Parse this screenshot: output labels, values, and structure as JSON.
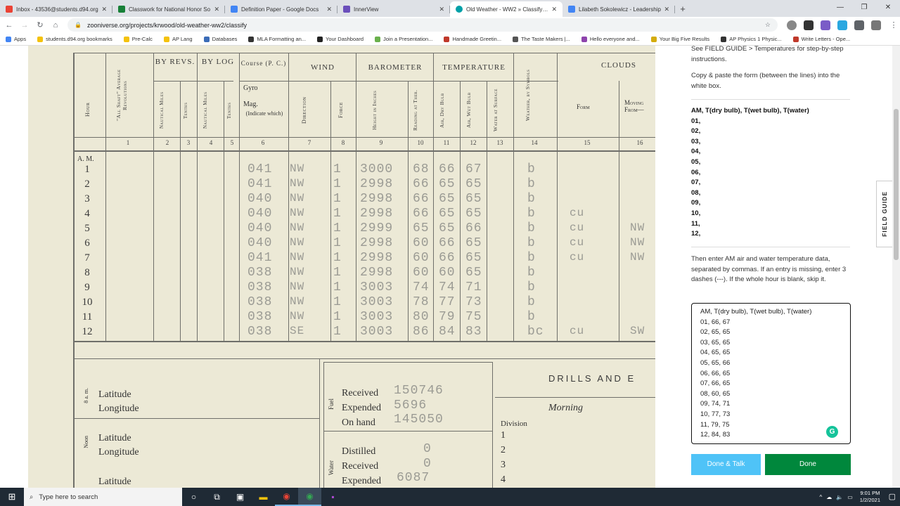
{
  "browser": {
    "tabs": [
      {
        "title": "Inbox - 43536@students.d94.org",
        "color": "#ea4335"
      },
      {
        "title": "Classwork for National Honor So",
        "color": "#188038"
      },
      {
        "title": "Definition Paper - Google Docs",
        "color": "#4285f4"
      },
      {
        "title": "InnerView",
        "color": "#6b4fbb"
      },
      {
        "title": "Old Weather - WW2 » Classify —",
        "color": "#00a0a8"
      },
      {
        "title": "Lilabeth Sokolewicz - Leadership",
        "color": "#4285f4"
      }
    ],
    "url": "zooniverse.org/projects/krwood/old-weather-ww2/classify",
    "bookmarks": [
      "Apps",
      "students.d94.org bookmarks",
      "Pre-Calc",
      "AP Lang",
      "Databases",
      "MLA Formatting an...",
      "Your Dashboard",
      "Join a Presentation...",
      "Handmade Greetin...",
      "The Taste Makers |...",
      "Hello everyone and...",
      "Your Big Five Results",
      "AP Physics 1 Physic...",
      "Write Letters - Ope..."
    ]
  },
  "logsheet": {
    "headers": {
      "hour": "Hour",
      "all_shaft": "\"All Shaft\" Average Revolutions",
      "by_revs": "BY REVS.",
      "by_log": "BY LOG",
      "nautical_miles": "Nautical Miles",
      "tenths": "Tenths",
      "course": "Course (P. C.)",
      "gyro": "Gyro",
      "mag": "Mag.",
      "indicate": "(Indicate which)",
      "wind": "WIND",
      "direction": "Direction",
      "force": "Force",
      "barometer": "BAROMETER",
      "height": "Height in Inches",
      "reading": "Reading at Ther.",
      "temperature": "TEMPERATURE",
      "air_dry": "Air, Dry Bulb",
      "air_wet": "Air, Wet Bulb",
      "water": "Water at Surface",
      "weather": "Weather, by Symbols",
      "clouds": "CLOUDS",
      "form": "Form",
      "moving": "Moving From—"
    },
    "col_numbers": [
      "1",
      "2",
      "3",
      "4",
      "5",
      "6",
      "7",
      "8",
      "9",
      "10",
      "11",
      "12",
      "13",
      "14",
      "15",
      "16"
    ],
    "am_label": "A. M.",
    "rows": [
      {
        "hour": "1",
        "course": "041",
        "dir": "NW",
        "force": "1",
        "baro": "3000",
        "therm": "68",
        "dry": "66",
        "wet": "67",
        "weather": "b",
        "form": "",
        "moving": ""
      },
      {
        "hour": "2",
        "course": "041",
        "dir": "NW",
        "force": "1",
        "baro": "2998",
        "therm": "66",
        "dry": "65",
        "wet": "65",
        "weather": "b",
        "form": "",
        "moving": ""
      },
      {
        "hour": "3",
        "course": "040",
        "dir": "NW",
        "force": "1",
        "baro": "2998",
        "therm": "66",
        "dry": "65",
        "wet": "65",
        "weather": "b",
        "form": "",
        "moving": ""
      },
      {
        "hour": "4",
        "course": "040",
        "dir": "NW",
        "force": "1",
        "baro": "2998",
        "therm": "66",
        "dry": "65",
        "wet": "65",
        "weather": "b",
        "form": "cu",
        "moving": ""
      },
      {
        "hour": "5",
        "course": "040",
        "dir": "NW",
        "force": "1",
        "baro": "2999",
        "therm": "65",
        "dry": "65",
        "wet": "66",
        "weather": "b",
        "form": "cu",
        "moving": "NW"
      },
      {
        "hour": "6",
        "course": "040",
        "dir": "NW",
        "force": "1",
        "baro": "2998",
        "therm": "60",
        "dry": "66",
        "wet": "65",
        "weather": "b",
        "form": "cu",
        "moving": "NW"
      },
      {
        "hour": "7",
        "course": "041",
        "dir": "NW",
        "force": "1",
        "baro": "2998",
        "therm": "60",
        "dry": "66",
        "wet": "65",
        "weather": "b",
        "form": "cu",
        "moving": "NW"
      },
      {
        "hour": "8",
        "course": "038",
        "dir": "NW",
        "force": "1",
        "baro": "2998",
        "therm": "60",
        "dry": "60",
        "wet": "65",
        "weather": "b",
        "form": "",
        "moving": ""
      },
      {
        "hour": "9",
        "course": "038",
        "dir": "NW",
        "force": "1",
        "baro": "3003",
        "therm": "74",
        "dry": "74",
        "wet": "71",
        "weather": "b",
        "form": "",
        "moving": ""
      },
      {
        "hour": "10",
        "course": "038",
        "dir": "NW",
        "force": "1",
        "baro": "3003",
        "therm": "78",
        "dry": "77",
        "wet": "73",
        "weather": "b",
        "form": "",
        "moving": ""
      },
      {
        "hour": "11",
        "course": "038",
        "dir": "NW",
        "force": "1",
        "baro": "3003",
        "therm": "80",
        "dry": "79",
        "wet": "75",
        "weather": "b",
        "form": "",
        "moving": ""
      },
      {
        "hour": "12",
        "course": "038",
        "dir": "SE",
        "force": "1",
        "baro": "3003",
        "therm": "86",
        "dry": "84",
        "wet": "83",
        "weather": "bc",
        "form": "cu",
        "moving": "SW"
      }
    ],
    "bottom": {
      "latitude": "Latitude",
      "longitude": "Longitude",
      "am8": "8 a. m.",
      "noon": "Noon",
      "fuel": "Fuel",
      "water": "Water",
      "received": "Received",
      "expended": "Expended",
      "on_hand": "On hand",
      "distilled": "Distilled",
      "fuel_received": "150746",
      "fuel_expended": "5696",
      "fuel_on_hand": "145050",
      "water_distilled": "0",
      "water_received": "0",
      "water_expended": "6087",
      "drills": "DRILLS AND E",
      "morning": "Morning",
      "division": "Division",
      "div_nums": [
        "1",
        "2",
        "3",
        "4"
      ]
    }
  },
  "panel": {
    "intro": "See FIELD GUIDE > Temperatures for step-by-step instructions.",
    "copy_text": "Copy & paste the form (between the lines) into the white box.",
    "form_lines": [
      "AM, T(dry bulb), T(wet bulb), T(water)",
      "01,",
      "02,",
      "03,",
      "04,",
      "05,",
      "06,",
      "07,",
      "08,",
      "09,",
      "10,",
      "11,",
      "12,"
    ],
    "then_text": "Then enter AM air and water temperature data, separated by commas. If an entry is missing, enter 3 dashes (---). If the whole hour is blank, skip it.",
    "answer_lines": [
      "AM, T(dry bulb), T(wet bulb), T(water)",
      "01, 66, 67",
      "02, 65, 65",
      "03, 65, 65",
      "04, 65, 65",
      "05, 65, 66",
      "06, 66, 65",
      "07, 66, 65",
      "08, 60, 65",
      "09, 74, 71",
      "10, 77, 73",
      "11, 79, 75",
      "12, 84, 83"
    ],
    "done_talk": "Done & Talk",
    "done": "Done",
    "field_guide": "FIELD GUIDE"
  },
  "taskbar": {
    "search_placeholder": "Type here to search",
    "time": "9:01 PM",
    "date": "1/2/2021"
  }
}
